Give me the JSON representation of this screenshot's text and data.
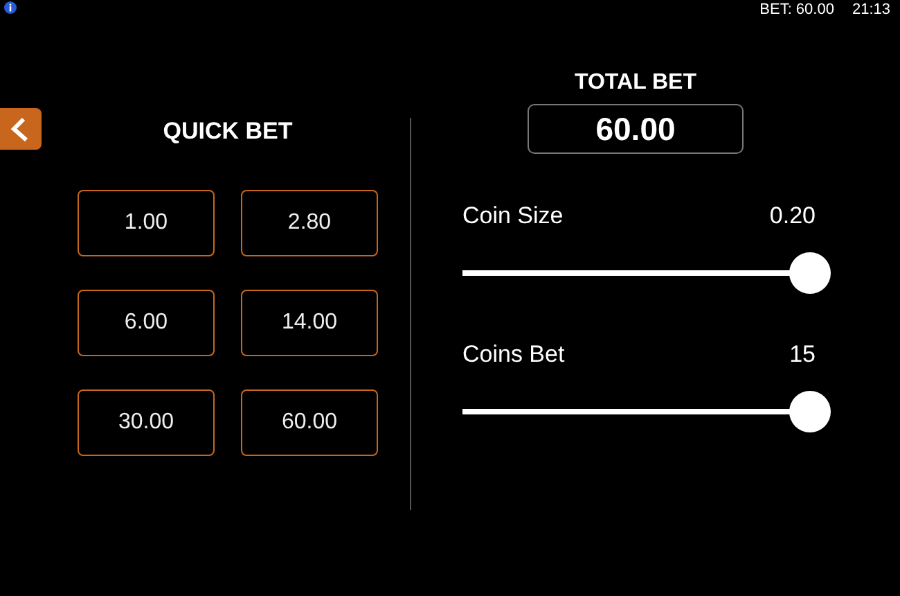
{
  "status_bar": {
    "bet": "BET: 60.00",
    "time": "21:13"
  },
  "quick_bet": {
    "title": "QUICK BET",
    "options": [
      "1.00",
      "2.80",
      "6.00",
      "14.00",
      "30.00",
      "60.00"
    ]
  },
  "total_bet": {
    "title": "TOTAL BET",
    "value": "60.00"
  },
  "sliders": [
    {
      "label": "Coin Size",
      "reading": "0.20",
      "level": 1.0
    },
    {
      "label": "Coins Bet",
      "reading": "15",
      "level": 1.0
    }
  ]
}
